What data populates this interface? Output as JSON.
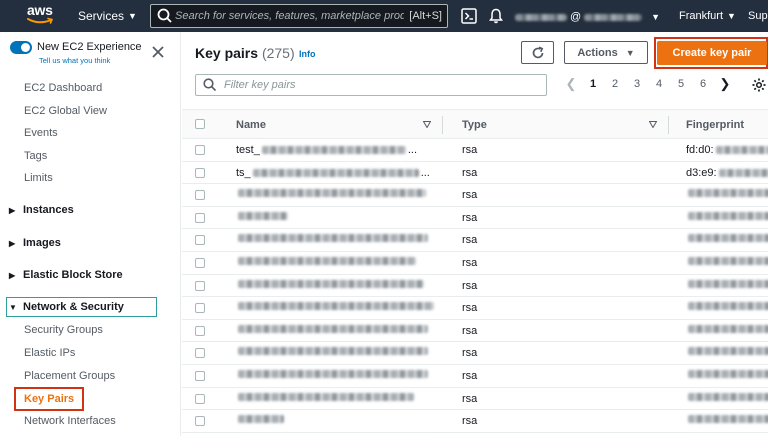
{
  "topnav": {
    "logo_text": "aws",
    "services_label": "Services",
    "search_placeholder": "Search for services, features, marketplace produ",
    "search_shortcut": "[Alt+S]",
    "account_at": "@",
    "region_label": "Frankfurt",
    "support_label": "Supp"
  },
  "sidebar": {
    "experience_title": "New EC2 Experience",
    "experience_link": "Tell us what you think",
    "items": {
      "dashboard": "EC2 Dashboard",
      "global_view": "EC2 Global View",
      "events": "Events",
      "tags": "Tags",
      "limits": "Limits"
    },
    "groups": {
      "instances": "Instances",
      "images": "Images",
      "ebs": "Elastic Block Store",
      "network_security": "Network & Security"
    },
    "network_items": {
      "security_groups": "Security Groups",
      "elastic_ips": "Elastic IPs",
      "placement_groups": "Placement Groups",
      "key_pairs": "Key Pairs",
      "network_interfaces": "Network Interfaces"
    }
  },
  "main": {
    "title": "Key pairs",
    "count": "(275)",
    "info_link": "Info",
    "actions_label": "Actions",
    "create_label": "Create key pair",
    "filter_placeholder": "Filter key pairs",
    "pages": [
      "1",
      "2",
      "3",
      "4",
      "5",
      "6"
    ],
    "current_page": "1",
    "columns": {
      "name": "Name",
      "type": "Type",
      "fingerprint": "Fingerprint"
    },
    "rows": [
      {
        "name_prefix": "test_",
        "name_suffix": "...",
        "type": "rsa",
        "fp_prefix": "fd:d0:"
      },
      {
        "name_prefix": "ts_",
        "name_suffix": "...",
        "type": "rsa",
        "fp_prefix": "d3:e9:"
      },
      {
        "name_prefix": "",
        "name_suffix": "",
        "type": "rsa",
        "fp_prefix": ""
      },
      {
        "name_prefix": "",
        "name_suffix": "",
        "type": "rsa",
        "fp_prefix": ""
      },
      {
        "name_prefix": "",
        "name_suffix": "",
        "type": "rsa",
        "fp_prefix": ""
      },
      {
        "name_prefix": "",
        "name_suffix": "",
        "type": "rsa",
        "fp_prefix": ""
      },
      {
        "name_prefix": "",
        "name_suffix": "",
        "type": "rsa",
        "fp_prefix": ""
      },
      {
        "name_prefix": "",
        "name_suffix": "",
        "type": "rsa",
        "fp_prefix": ""
      },
      {
        "name_prefix": "",
        "name_suffix": "",
        "type": "rsa",
        "fp_prefix": ""
      },
      {
        "name_prefix": "",
        "name_suffix": "",
        "type": "rsa",
        "fp_prefix": ""
      },
      {
        "name_prefix": "",
        "name_suffix": "",
        "type": "rsa",
        "fp_prefix": ""
      },
      {
        "name_prefix": "",
        "name_suffix": "",
        "type": "rsa",
        "fp_prefix": ""
      },
      {
        "name_prefix": "",
        "name_suffix": "",
        "type": "rsa",
        "fp_prefix": ""
      },
      {
        "name_prefix": "",
        "name_suffix": "",
        "type": "rsa",
        "fp_prefix": ""
      }
    ]
  },
  "colors": {
    "nav_bg": "#232f3e",
    "accent_orange": "#ec7211",
    "link_blue": "#0073bb",
    "highlight_red": "#d13212",
    "highlight_teal": "#2e9e9e"
  },
  "icons": {
    "cloudshell": "cloudshell-icon",
    "notifications": "bell-icon",
    "settings": "gear-icon",
    "refresh": "refresh-icon"
  }
}
